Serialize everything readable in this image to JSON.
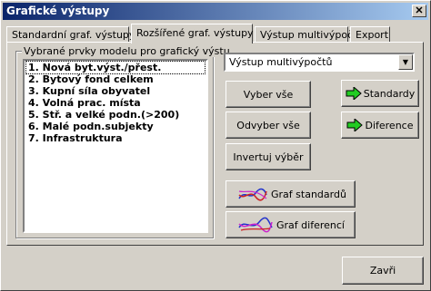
{
  "window": {
    "title": "Grafické výstupy"
  },
  "tabs": [
    {
      "label": "Standardní graf. výstupy"
    },
    {
      "label": "Rozšířené graf. výstupy"
    },
    {
      "label": "Výstup multivýpočtů"
    },
    {
      "label": "Export"
    }
  ],
  "groupbox": {
    "legend": "Vybrané prvky modelu pro grafický výstu"
  },
  "list": {
    "items": [
      "1. Nová byt.výst./přest.",
      "2. Bytový fond celkem",
      "3. Kupní síla obyvatel",
      "4. Volná prac. místa",
      "5. Stř. a velké podn.(>200)",
      "6. Malé podn.subjekty",
      "7. Infrastruktura"
    ]
  },
  "dropdown": {
    "value": "Výstup multivýpočtů"
  },
  "buttons": {
    "select_all": "Vyber vše",
    "deselect_all": "Odvyber vše",
    "invert": "Invertuj výběr",
    "standards": "Standardy",
    "differences": "Diference",
    "graph_standards": "Graf standardů",
    "graph_differences": "Graf diferencí",
    "close": "Zavři"
  },
  "colors": {
    "arrow_green": "#22cc22",
    "title_start": "#0a246a",
    "title_end": "#a6caf0"
  }
}
